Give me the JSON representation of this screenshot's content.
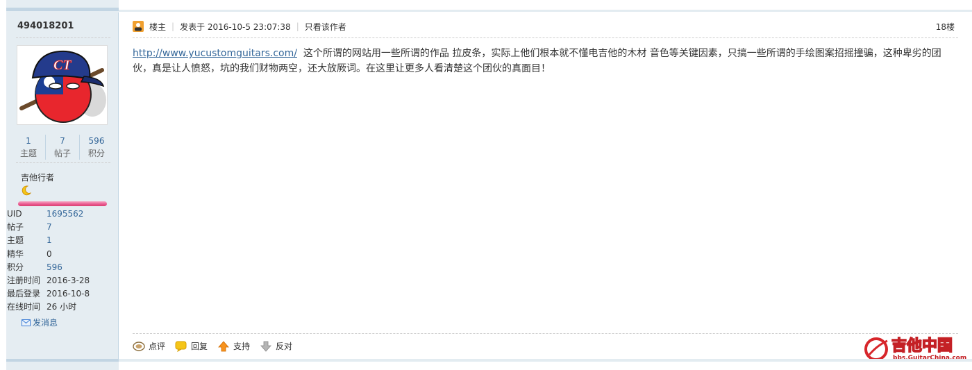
{
  "author": {
    "username": "494018201",
    "stats": [
      {
        "value": "1",
        "label": "主题"
      },
      {
        "value": "7",
        "label": "帖子"
      },
      {
        "value": "596",
        "label": "积分"
      }
    ],
    "group": "吉他行者",
    "rank_icon": "moon-icon",
    "info": [
      {
        "key": "UID",
        "value": "1695562",
        "link": true
      },
      {
        "key": "帖子",
        "value": "7",
        "link": true
      },
      {
        "key": "主题",
        "value": "1",
        "link": true
      },
      {
        "key": "精华",
        "value": "0",
        "link": false
      },
      {
        "key": "积分",
        "value": "596",
        "link": true
      },
      {
        "key": "注册时间",
        "value": "2016-3-28",
        "link": false
      },
      {
        "key": "最后登录",
        "value": "2016-10-8",
        "link": false
      },
      {
        "key": "在线时间",
        "value": "26 小时",
        "link": false
      }
    ],
    "send_pm": "发消息"
  },
  "post": {
    "op_label": "楼主",
    "posted_at": "发表于 2016-10-5 23:07:38",
    "only_author": "只看该作者",
    "floor": "18楼",
    "link_text": "http://www.yucustomguitars.com/",
    "body": "这个所谓的网站用一些所谓的作品 拉皮条，实际上他们根本就不懂电吉他的木材 音色等关键因素，只搞一些所谓的手绘图案招摇撞骗，这种卑劣的团伙，真是让人愤怒，坑的我们财物两空，还大放厥词。在这里让更多人看清楚这个团伙的真面目！",
    "actions": [
      {
        "label": "点评",
        "icon": "comment-icon"
      },
      {
        "label": "回复",
        "icon": "reply-icon"
      },
      {
        "label": "支持",
        "icon": "thumbs-up-arrow-icon"
      },
      {
        "label": "反对",
        "icon": "thumbs-down-arrow-icon"
      }
    ]
  },
  "watermark": {
    "title": "吉他中国",
    "url": "bbs.GuitarChina.com"
  },
  "colors": {
    "sidebar_bg": "#e5edf2",
    "link": "#336699",
    "border": "#c2d5e3",
    "watermark_red": "#d7262b"
  }
}
